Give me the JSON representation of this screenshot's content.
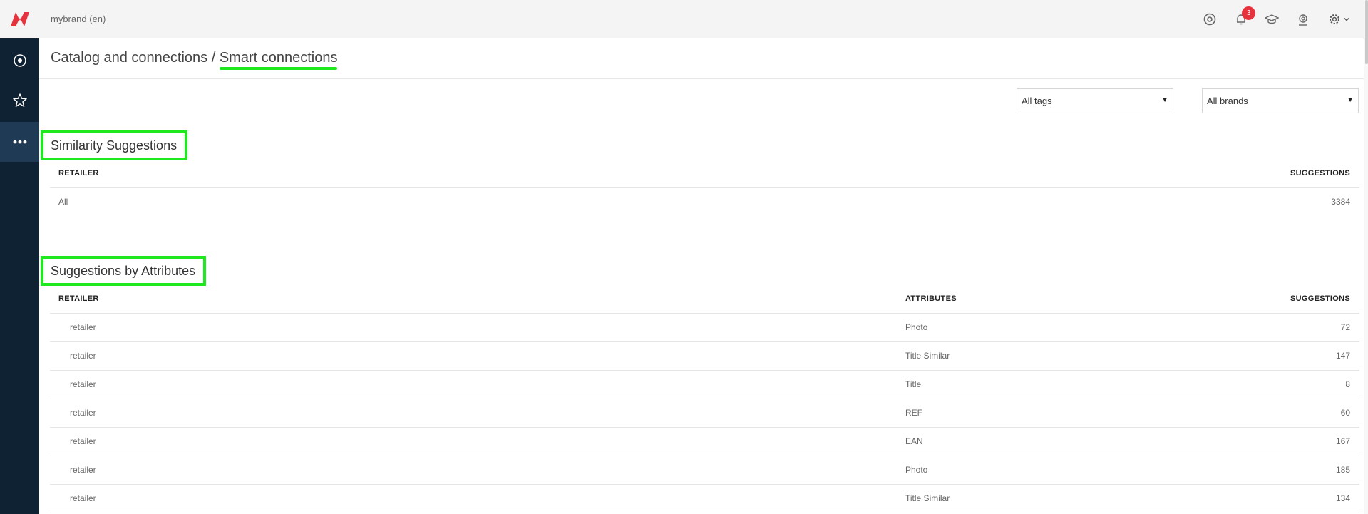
{
  "header": {
    "brand_label": "mybrand (en)",
    "notifications_count": "3",
    "icons": [
      "logo-icon",
      "chrome-icon",
      "bell-icon",
      "graduation-cap-icon",
      "support-agent-icon",
      "gear-icon",
      "chevron-down-icon"
    ]
  },
  "sidebar": {
    "items": [
      {
        "icon": "target-icon",
        "active": false
      },
      {
        "icon": "star-icon",
        "active": false
      },
      {
        "icon": "more-dots-icon",
        "active": true
      }
    ]
  },
  "breadcrumb": {
    "parent": "Catalog and connections",
    "separator": "/",
    "current": "Smart connections"
  },
  "filters": {
    "tags": "All tags",
    "brands": "All brands"
  },
  "similarity": {
    "title": "Similarity Suggestions",
    "columns": {
      "retailer": "RETAILER",
      "suggestions": "SUGGESTIONS"
    },
    "rows": [
      {
        "retailer": "All",
        "suggestions": "3384"
      }
    ]
  },
  "attributes": {
    "title": "Suggestions by Attributes",
    "columns": {
      "retailer": "RETAILER",
      "attributes": "ATTRIBUTES",
      "suggestions": "SUGGESTIONS"
    },
    "rows": [
      {
        "retailer": "retailer",
        "attribute": "Photo",
        "suggestions": "72"
      },
      {
        "retailer": "retailer",
        "attribute": "Title Similar",
        "suggestions": "147"
      },
      {
        "retailer": "retailer",
        "attribute": "Title",
        "suggestions": "8"
      },
      {
        "retailer": "retailer",
        "attribute": "REF",
        "suggestions": "60"
      },
      {
        "retailer": "retailer",
        "attribute": "EAN",
        "suggestions": "167"
      },
      {
        "retailer": "retailer",
        "attribute": "Photo",
        "suggestions": "185"
      },
      {
        "retailer": "retailer",
        "attribute": "Title Similar",
        "suggestions": "134"
      }
    ]
  },
  "colors": {
    "accent_highlight": "#1ee81e",
    "brand_red": "#e5323c",
    "sidebar_bg": "#0f2233",
    "sidebar_active": "#1f3a55"
  }
}
